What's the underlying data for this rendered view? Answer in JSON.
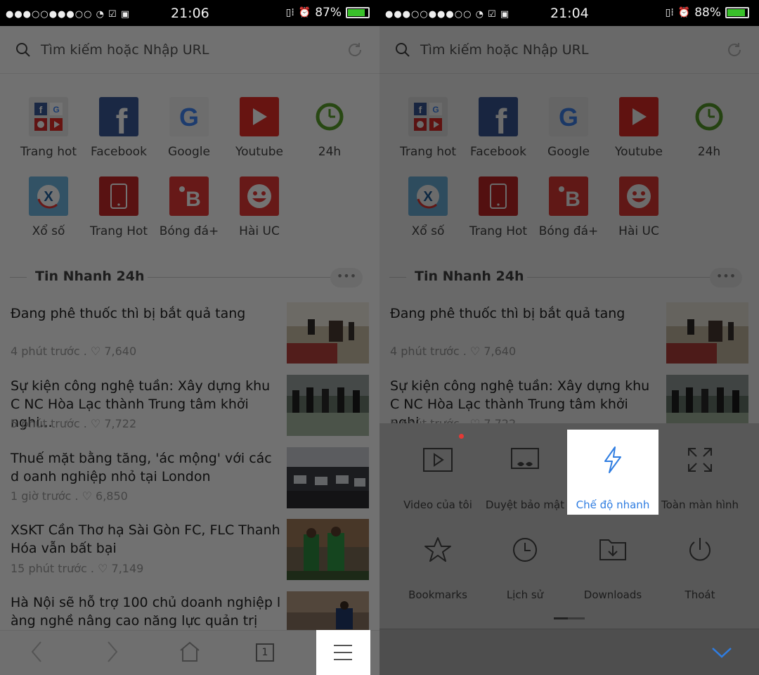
{
  "left": {
    "status": {
      "time": "21:06",
      "battery": "87%",
      "battery_level": 0.87
    },
    "search": {
      "placeholder": "Tìm kiếm hoặc Nhập URL"
    },
    "quick_links": [
      {
        "label": "Trang hot",
        "icon": "grid-apps-icon"
      },
      {
        "label": "Facebook",
        "icon": "facebook-icon"
      },
      {
        "label": "Google",
        "icon": "google-icon"
      },
      {
        "label": "Youtube",
        "icon": "youtube-icon"
      },
      {
        "label": "24h",
        "icon": "clock-24h-icon"
      },
      {
        "label": "Xổ số",
        "icon": "lottery-icon"
      },
      {
        "label": "Trang Hot",
        "icon": "phone-icon"
      },
      {
        "label": "Bóng đá+",
        "icon": "football-icon"
      },
      {
        "label": "Hài UC",
        "icon": "smiley-icon"
      }
    ],
    "section_title": "Tin Nhanh 24h",
    "more": "•••",
    "news": [
      {
        "title": "Đang phê thuốc thì bị bắt quả tang",
        "meta": "4 phút trước . ♡ 7,640"
      },
      {
        "title": "Sự kiện công nghệ tuần: Xây dựng khu C NC Hòa Lạc thành Trung tâm khởi nghi...",
        "meta": "5 phút trước . ♡ 7,722"
      },
      {
        "title": "Thuế mặt bằng tăng, 'ác mộng' với các d oanh nghiệp nhỏ tại London",
        "meta": "1 giờ trước . ♡ 6,850"
      },
      {
        "title": "XSKT Cần Thơ hạ Sài Gòn FC, FLC Thanh Hóa vẫn bất bại",
        "meta": "15 phút trước . ♡ 7,149"
      },
      {
        "title": "Hà Nội sẽ hỗ trợ 100 chủ doanh nghiệp l àng nghề nâng cao năng lực quản trị",
        "meta": ""
      }
    ],
    "bottom": {
      "tab_count": "1"
    }
  },
  "right": {
    "status": {
      "time": "21:04",
      "battery": "88%",
      "battery_level": 0.88
    },
    "search": {
      "placeholder": "Tìm kiếm hoặc Nhập URL"
    },
    "quick_links": [
      {
        "label": "Trang hot"
      },
      {
        "label": "Facebook"
      },
      {
        "label": "Google"
      },
      {
        "label": "Youtube"
      },
      {
        "label": "24h"
      },
      {
        "label": "Xổ số"
      },
      {
        "label": "Trang Hot"
      },
      {
        "label": "Bóng đá+"
      },
      {
        "label": "Hài UC"
      }
    ],
    "section_title": "Tin Nhanh 24h",
    "more": "•••",
    "news": [
      {
        "title": "Đang phê thuốc thì bị bắt quả tang",
        "meta": "4 phút trước . ♡ 7,640"
      },
      {
        "title": "Sự kiện công nghệ tuần: Xây dựng khu C NC Hòa Lạc thành Trung tâm khởi nghi...",
        "meta": "5 phút trước . ♡ 7,722"
      }
    ],
    "menu": [
      {
        "label": "Video của tôi",
        "icon": "video-icon"
      },
      {
        "label": "Duyệt bảo mật",
        "icon": "incognito-icon"
      },
      {
        "label": "Chế độ nhanh",
        "icon": "lightning-icon",
        "active": true
      },
      {
        "label": "Toàn màn hình",
        "icon": "fullscreen-icon"
      },
      {
        "label": "Bookmarks",
        "icon": "star-icon"
      },
      {
        "label": "Lịch sử",
        "icon": "history-icon"
      },
      {
        "label": "Downloads",
        "icon": "downloads-icon"
      },
      {
        "label": "Thoát",
        "icon": "power-icon"
      }
    ],
    "colors": {
      "accent": "#2f7de1",
      "badge": "#e53935"
    }
  }
}
